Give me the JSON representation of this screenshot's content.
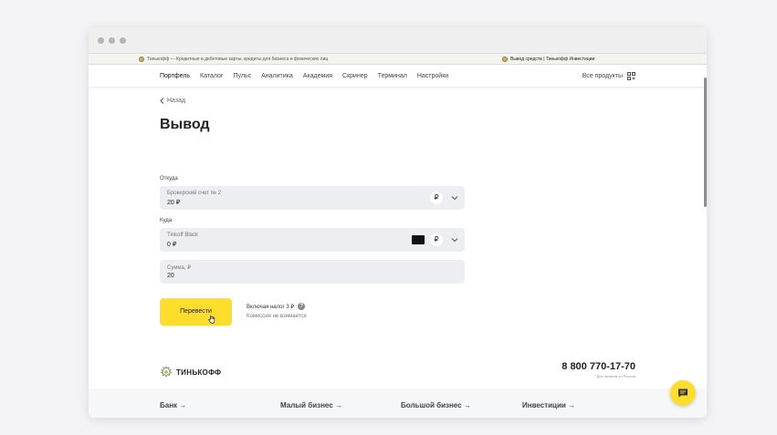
{
  "browser": {
    "tabs": [
      {
        "label": "Тинькофф — Кредитные и дебетовые карты, кредиты для бизнеса и физических лиц",
        "active": false
      },
      {
        "label": "Вывод средств | Тинькофф Инвестиции",
        "active": true
      }
    ]
  },
  "nav": {
    "items": [
      "Портфель",
      "Каталог",
      "Пульс",
      "Аналитика",
      "Академия",
      "Скринер",
      "Терминал",
      "Настройки"
    ],
    "active_index": 0,
    "all_products": "Все продукты"
  },
  "page": {
    "back_label": "Назад",
    "title": "Вывод",
    "from": {
      "label": "Откуда",
      "field_label": "Брокерский счет № 2",
      "field_value": "20 ₽",
      "currency": "₽"
    },
    "to": {
      "label": "Куда",
      "field_label": "Tinkoff Black",
      "field_value": "0 ₽",
      "currency": "₽"
    },
    "amount": {
      "field_label": "Сумма, ₽",
      "field_value": "20"
    },
    "submit_label": "Перевести",
    "fee_title": "Включая налог 3 ₽",
    "fee_subtitle": "Комиссия не взимается"
  },
  "footer": {
    "brand": "ТИНЬКОФФ",
    "phone": "8 800 770-17-70",
    "phone_caption": "Для звонков по России",
    "categories": [
      "Банк →",
      "Малый бизнес →",
      "Большой бизнес →",
      "Инвестиции →"
    ]
  },
  "colors": {
    "accent": "#ffdd2d",
    "field_bg": "#eceef2"
  }
}
